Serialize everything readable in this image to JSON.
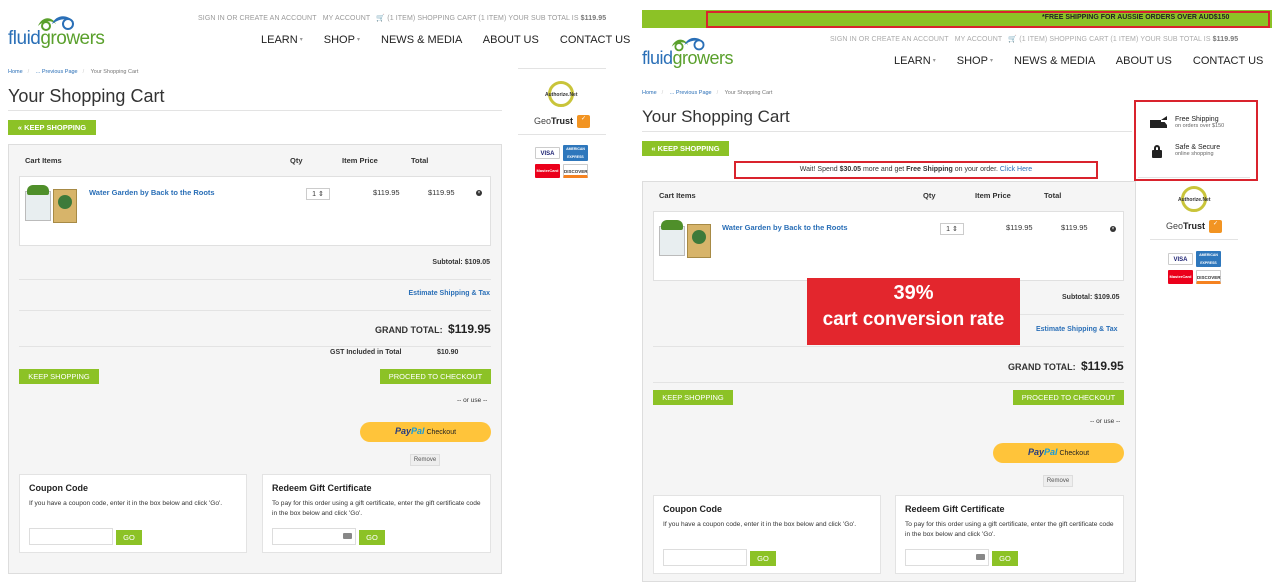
{
  "left": {
    "logo": {
      "part1": "fluid",
      "part2": "growers"
    },
    "toplinks": {
      "signin": "SIGN IN OR CREATE AN ACCOUNT",
      "account": "MY ACCOUNT",
      "cart": "(1 ITEM)  SHOPPING CART  (1 ITEM) YOUR SUB TOTAL IS",
      "subtotal": "$119.95"
    },
    "nav": [
      "LEARN",
      "SHOP",
      "NEWS & MEDIA",
      "ABOUT US",
      "CONTACT US"
    ],
    "breadcrumb": {
      "home": "Home",
      "prev": "... Previous Page",
      "current": "Your Shopping Cart"
    },
    "title": "Your Shopping Cart",
    "keep_shopping_top": "KEEP SHOPPING",
    "columns": {
      "items": "Cart Items",
      "qty": "Qty",
      "price": "Item Price",
      "total": "Total"
    },
    "item": {
      "name": "Water Garden by Back to the Roots",
      "qty": "1",
      "price": "$119.95",
      "total": "$119.95"
    },
    "subtotal": "Subtotal: $109.05",
    "estimate": "Estimate Shipping & Tax",
    "grand_total_label": "GRAND TOTAL:",
    "grand_total_value": "$119.95",
    "gst_label": "GST Included in Total",
    "gst_value": "$10.90",
    "keep_shopping": "KEEP SHOPPING",
    "checkout": "PROCEED TO CHECKOUT",
    "or_use": "-- or use --",
    "paypal": {
      "pay": "Pay",
      "pal": "Pal",
      "checkout": "Checkout"
    },
    "remove": "Remove",
    "coupon": {
      "title": "Coupon Code",
      "text": "If you have a coupon code, enter it in the box below and click 'Go'.",
      "go": "GO"
    },
    "gift": {
      "title": "Redeem Gift Certificate",
      "text": "To pay for this order using a gift certificate, enter the gift certificate code in the box below and click 'Go'.",
      "go": "GO"
    },
    "badges": {
      "authorize": "Authorize.Net",
      "geotrust_geo": "Geo",
      "geotrust_trust": "Trust",
      "visa": "VISA",
      "amex": "AMERICAN EXPRESS",
      "mastercard": "MasterCard",
      "discover": "DISCOVER"
    }
  },
  "right": {
    "promo": "*FREE SHIPPING FOR AUSSIE ORDERS OVER AUD$150",
    "logo": {
      "part1": "fluid",
      "part2": "growers"
    },
    "toplinks": {
      "signin": "SIGN IN OR CREATE AN ACCOUNT",
      "account": "MY ACCOUNT",
      "cart": "(1 ITEM)  SHOPPING CART  (1 ITEM) YOUR SUB TOTAL IS",
      "subtotal": "$119.95"
    },
    "nav": [
      "LEARN",
      "SHOP",
      "NEWS & MEDIA",
      "ABOUT US",
      "CONTACT US"
    ],
    "breadcrumb": {
      "home": "Home",
      "prev": "... Previous Page",
      "current": "Your Shopping Cart"
    },
    "title": "Your Shopping Cart",
    "keep_shopping_top": "KEEP SHOPPING",
    "wait": {
      "a": "Wait! Spend ",
      "amount": "$30.05",
      "b": " more and get ",
      "free": "Free Shipping",
      "c": " on your order. ",
      "link": "Click Here"
    },
    "features": {
      "ship_title": "Free Shipping",
      "ship_sub": "on orders over $150",
      "secure_title": "Safe & Secure",
      "secure_sub": "online shopping"
    },
    "columns": {
      "items": "Cart Items",
      "qty": "Qty",
      "price": "Item Price",
      "total": "Total"
    },
    "item": {
      "name": "Water Garden by Back to the Roots",
      "qty": "1",
      "price": "$119.95",
      "total": "$119.95"
    },
    "banner": {
      "pct": "39%",
      "label": "cart conversion rate"
    },
    "subtotal": "Subtotal: $109.05",
    "estimate": "Estimate Shipping & Tax",
    "grand_total_label": "GRAND TOTAL:",
    "grand_total_value": "$119.95",
    "keep_shopping": "KEEP SHOPPING",
    "checkout": "PROCEED TO CHECKOUT",
    "or_use": "-- or use --",
    "paypal": {
      "pay": "Pay",
      "pal": "Pal",
      "checkout": "Checkout"
    },
    "remove": "Remove",
    "coupon": {
      "title": "Coupon Code",
      "text": "If you have a coupon code, enter it in the box below and click 'Go'.",
      "go": "GO"
    },
    "gift": {
      "title": "Redeem Gift Certificate",
      "text": "To pay for this order using a gift certificate, enter the gift certificate code in the box below and click 'Go'.",
      "go": "GO"
    },
    "badges": {
      "authorize": "Authorize.Net",
      "geotrust_geo": "Geo",
      "geotrust_trust": "Trust",
      "visa": "VISA",
      "amex": "AMERICAN EXPRESS",
      "mastercard": "MasterCard",
      "discover": "DISCOVER"
    }
  }
}
